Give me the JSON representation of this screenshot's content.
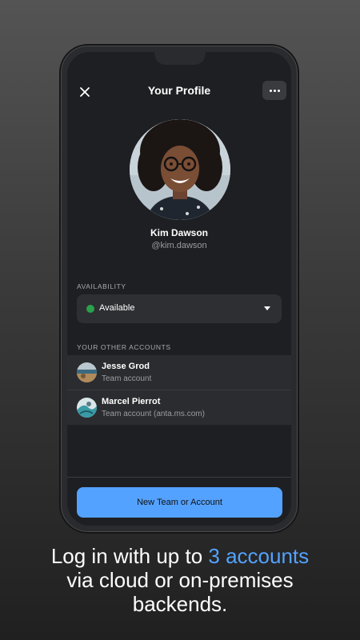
{
  "header": {
    "title": "Your Profile",
    "close_icon": "close-icon",
    "more_icon": "more-horizontal-icon"
  },
  "profile": {
    "name": "Kim Dawson",
    "handle": "@kim.dawson"
  },
  "availability": {
    "label": "AVAILABILITY",
    "selected": "Available",
    "status_color": "#2aa24a"
  },
  "other_accounts": {
    "label": "YOUR OTHER ACCOUNTS",
    "items": [
      {
        "name": "Jesse Grod",
        "subtitle": "Team account"
      },
      {
        "name": "Marcel Pierrot",
        "subtitle": "Team account (anta.ms.com)"
      }
    ]
  },
  "footer": {
    "new_account_label": "New Team or Account"
  },
  "caption": {
    "line1_prefix": "Log in with up to ",
    "line1_highlight": "3 accounts",
    "line2": "via cloud or on-premises",
    "line3": "backends."
  },
  "colors": {
    "accent": "#54a2ff",
    "background": "#1e1f22"
  }
}
